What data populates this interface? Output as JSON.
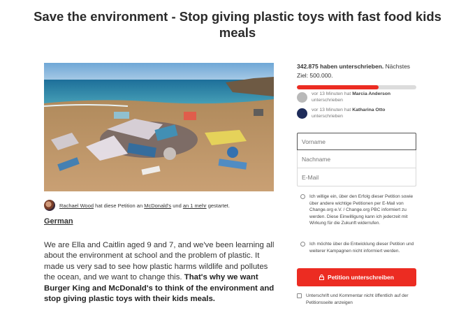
{
  "petition": {
    "title": "Save the environment - Stop giving plastic toys with fast food kids meals",
    "author_name": "Rachael Wood",
    "author_text_1": " hat diese Petition an ",
    "recipient": "McDonald's",
    "author_text_2": " und ",
    "more_link": "an 1 mehr",
    "author_text_3": " gestartet.",
    "language": "German",
    "story_plain": "We are Ella and Caitlin aged 9 and 7, and we've been learning all about the environment at school and the problem of plastic. It made us very sad to see how plastic harms wildlife and pollutes the ocean, and we want to change this. ",
    "story_bold": "That's why we want Burger King and McDonald's to think of the environment and stop giving plastic toys with their kids meals."
  },
  "signatures": {
    "count_bold": "342.875 haben unterschrieben.",
    "next_goal": " Nächstes Ziel: 500.000.",
    "progress_fraction": 0.686
  },
  "recent_signers": [
    {
      "time_text": "vor 13 Minuten hat ",
      "name": "Marcia Anderson",
      "suffix": "unterschrieben",
      "avatar_color": "#b9b9b9"
    },
    {
      "time_text": "vor 13 Minuten hat ",
      "name": "Katharina Otto",
      "suffix": "unterschrieben",
      "avatar_color": "#1e2c5a"
    }
  ],
  "form": {
    "first_name_placeholder": "Vorname",
    "last_name_placeholder": "Nachname",
    "email_placeholder": "E-Mail",
    "consent_changeorg": "Ich willige ein, über den Erfolg dieser Petition sowie über andere wichtige Petitionen per E-Mail von Change.org e.V. / Change.org PBC informiert zu werden. Diese Einwilligung kann ich jederzeit mit Wirkung für die Zukunft widerrufen.",
    "consent_decline": "Ich möchte über die Entwicklung dieser Petition und weiterer Kampagnen nicht informiert werden.",
    "sign_button": "Petition unterschreiben",
    "hide_signature": "Unterschrift und Kommentar nicht öffentlich auf der Petitionsseite anzeigen"
  },
  "colors": {
    "accent": "#ec2c22"
  }
}
